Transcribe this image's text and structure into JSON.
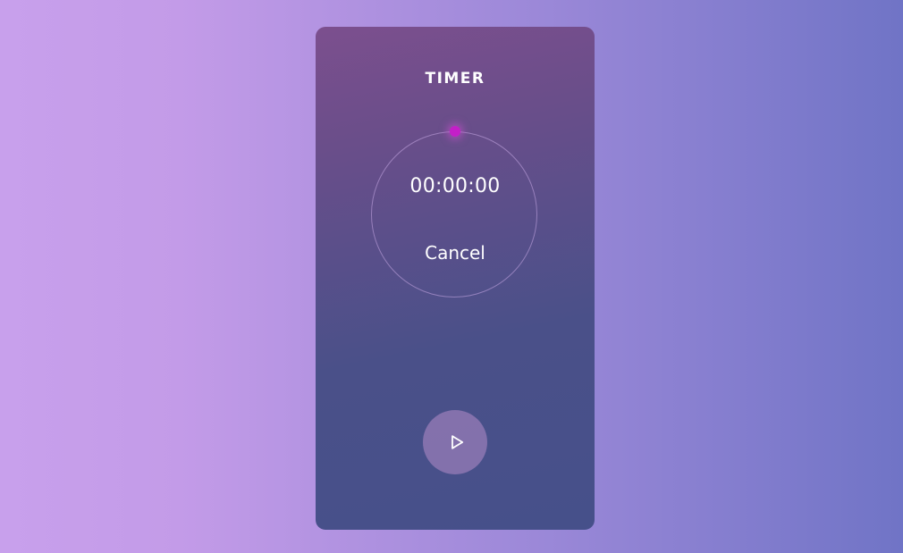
{
  "timer": {
    "title": "TIMER",
    "time": "00:00:00",
    "cancel_label": "Cancel",
    "progress": 0
  },
  "controls": {
    "play_icon": "play-icon"
  },
  "colors": {
    "accent": "#c41fc8",
    "text": "#ffffff"
  }
}
